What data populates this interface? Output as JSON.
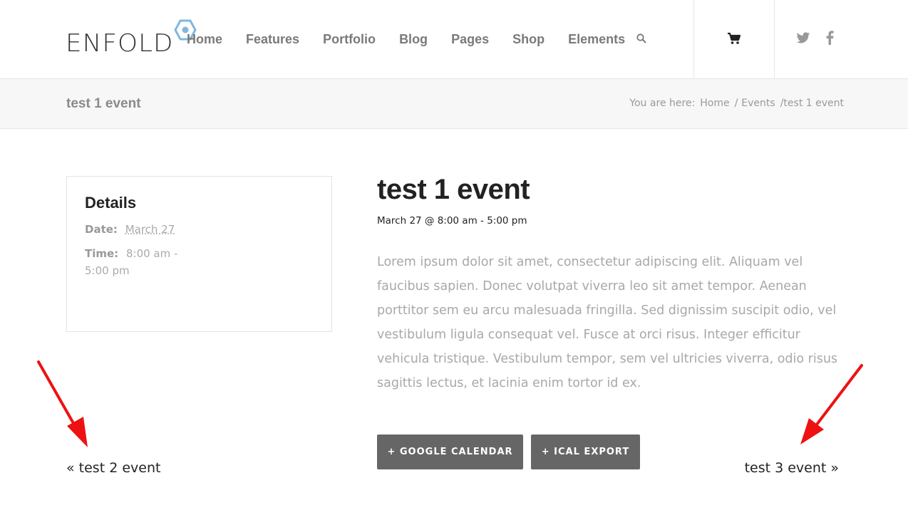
{
  "header": {
    "logo_text": "ENFOLD",
    "nav": [
      "Home",
      "Features",
      "Portfolio",
      "Blog",
      "Pages",
      "Shop",
      "Elements"
    ],
    "icons": [
      "search-icon",
      "cart-icon",
      "twitter-icon",
      "facebook-icon"
    ]
  },
  "titlebar": {
    "title": "test 1 event",
    "breadcrumb": {
      "label": "You are here:",
      "items": [
        "Home",
        "Events",
        "test 1 event"
      ]
    }
  },
  "details": {
    "heading": "Details",
    "date_label": "Date:",
    "date_value": "March 27",
    "time_label": "Time:",
    "time_value_1": "8:00 am -",
    "time_value_2": "5:00 pm"
  },
  "event": {
    "title": "test 1 event",
    "datetime": "March 27 @ 8:00 am - 5:00 pm",
    "description": "Lorem ipsum dolor sit amet, consectetur adipiscing elit. Aliquam vel faucibus sapien. Donec volutpat viverra leo sit amet tempor. Aenean porttitor sem eu arcu malesuada fringilla. Sed dignissim suscipit odio, vel vestibulum ligula consequat vel. Fusce at orci risus. Integer efficitur vehicula tristique. Vestibulum tempor, sem vel ultricies viverra, odio risus sagittis lectus, et lacinia enim tortor id ex."
  },
  "buttons": {
    "google_calendar": "+ GOOGLE CALENDAR",
    "ical_export": "+ ICAL EXPORT"
  },
  "pagination": {
    "prev": "« test 2 event",
    "next": "test 3 event »"
  },
  "colors": {
    "accent_logo": "#7fb8e0",
    "button_bg": "#666666",
    "annotation_arrow": "#ee1111"
  }
}
